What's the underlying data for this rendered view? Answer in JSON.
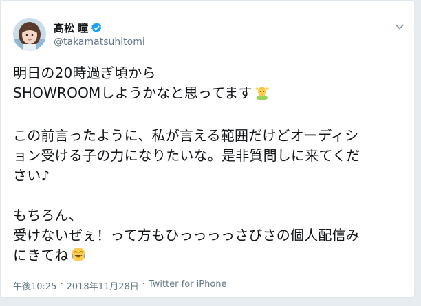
{
  "user": {
    "display_name": "髙松 瞳",
    "handle": "@takamatsuhitomi"
  },
  "tweet": {
    "lines": [
      "明日の20時過ぎ頃から",
      "SHOWROOMしようかなと思ってます",
      "",
      "この前言ったように、私が言える範囲だけどオーディシ",
      "ョン受ける子の力になりたいな。是非質問しに来てくだ",
      "さい♪",
      "",
      "もちろん、",
      "受けないぜぇ！って方もひっっっっさびさの個人配信み",
      "にきてね"
    ]
  },
  "meta": {
    "time": "午後10:25",
    "separator1": "·",
    "date": "2018年11月28日",
    "separator2": "·",
    "source": "Twitter for iPhone"
  },
  "icons": {
    "verified": "verified-badge-icon",
    "caret": "chevron-down-icon",
    "emoji1": "person-gesturing-ok-emoji",
    "emoji2": "face-with-tears-of-joy-emoji"
  },
  "colors": {
    "verified_blue": "#1da1f2",
    "text": "#14171a",
    "secondary": "#657786"
  }
}
